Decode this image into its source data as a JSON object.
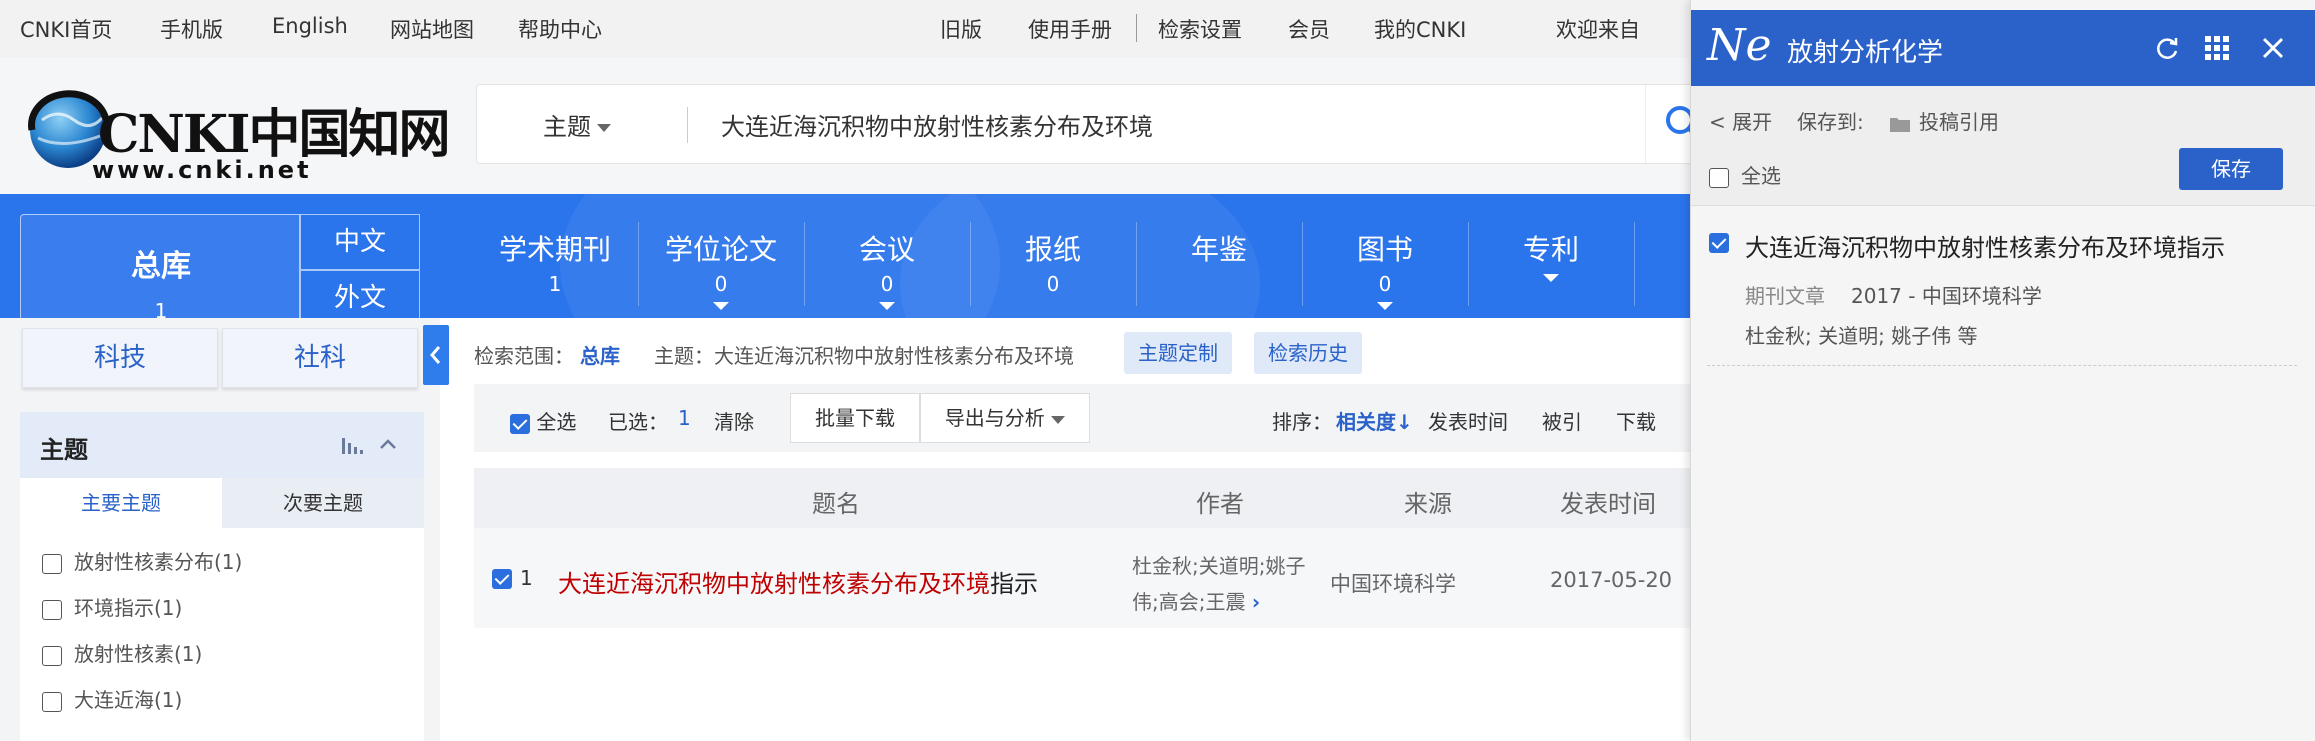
{
  "topbar": {
    "left": [
      "CNKI首页",
      "手机版",
      "English",
      "网站地图",
      "帮助中心"
    ],
    "right": [
      "旧版",
      "使用手册",
      "检索设置",
      "会员",
      "我的CNKI",
      "欢迎来自"
    ]
  },
  "logo": {
    "main": "CNKI中国知网",
    "url_text": "www.cnki.net"
  },
  "search": {
    "field": "主题",
    "query": "大连近海沉积物中放射性核素分布及环境"
  },
  "nav": {
    "total": {
      "label": "总库",
      "count": "1"
    },
    "lang": [
      "中文",
      "外文"
    ],
    "items": [
      {
        "label": "学术期刊",
        "count": "1"
      },
      {
        "label": "学位论文",
        "count": "0"
      },
      {
        "label": "会议",
        "count": "0"
      },
      {
        "label": "报纸",
        "count": "0"
      },
      {
        "label": "年鉴",
        "count": ""
      },
      {
        "label": "图书",
        "count": "0"
      },
      {
        "label": "专利",
        "count": ""
      }
    ]
  },
  "left": {
    "tabs": [
      "科技",
      "社科"
    ],
    "theme_title": "主题",
    "subtabs": [
      "主要主题",
      "次要主题"
    ],
    "facets": [
      "放射性核素分布(1)",
      "环境指示(1)",
      "放射性核素(1)",
      "大连近海(1)"
    ]
  },
  "range": {
    "label": "检索范围：",
    "scope": "总库",
    "theme": "主题：大连近海沉积物中放射性核素分布及环境",
    "btn_custom": "主题定制",
    "btn_history": "检索历史"
  },
  "toolbar": {
    "select_all": "全选",
    "selected_label": "已选：",
    "selected_count": "1",
    "clear": "清除",
    "batch_download": "批量下载",
    "export": "导出与分析",
    "sort_label": "排序：",
    "sort_relevance": "相关度",
    "sort_time": "发表时间",
    "sort_cited": "被引",
    "sort_download": "下载"
  },
  "table": {
    "headers": [
      "题名",
      "作者",
      "来源",
      "发表时间"
    ],
    "rows": [
      {
        "index": "1",
        "title_highlight": "大连近海沉积物中放射性核素分布及环境",
        "title_rest": "指示",
        "authors_line1": "杜金秋;关道明;姚子",
        "authors_line2": "伟;高会;王震",
        "source": "中国环境科学",
        "date": "2017-05-20"
      }
    ]
  },
  "side": {
    "logo": "Ne",
    "title": "放射分析化学",
    "expand": "< 展开",
    "save_to": "保存到:",
    "folder": "投稿引用",
    "select_all": "全选",
    "save": "保存",
    "entry": {
      "title": "大连近海沉积物中放射性核素分布及环境指示",
      "type": "期刊文章",
      "meta": "2017 - 中国环境科学",
      "authors": "杜金秋; 关道明; 姚子伟 等"
    }
  },
  "colors": {
    "brand_blue": "#2a74ec",
    "panel_blue": "#2a62c9",
    "highlight_red": "#c00000"
  }
}
